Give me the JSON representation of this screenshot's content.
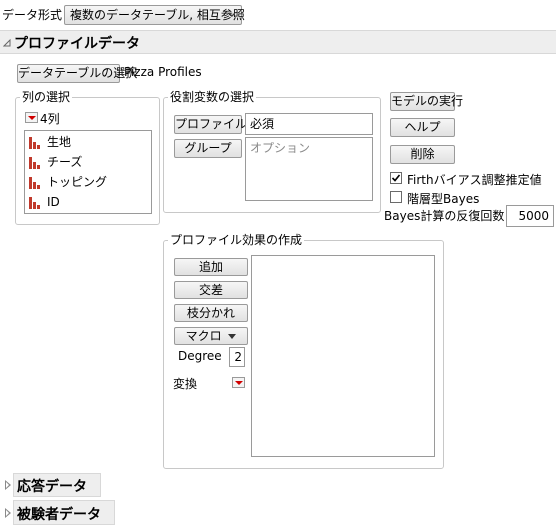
{
  "data_format": {
    "label": "データ形式",
    "value": "複数のデータテーブル, 相互参照"
  },
  "profile_section": {
    "title": "プロファイルデータ",
    "select_table_button": "データテーブルの選択",
    "table_name": "Pizza Profiles"
  },
  "column_select": {
    "title": "列の選択",
    "count_label": "4列",
    "columns": [
      "生地",
      "チーズ",
      "トッピング",
      "ID"
    ]
  },
  "role_select": {
    "title": "役割変数の選択",
    "profile_id_button": "プロファイルID",
    "profile_id_value": "必須",
    "group_button": "グループ",
    "group_placeholder": "オプション"
  },
  "actions": {
    "run_model": "モデルの実行",
    "help": "ヘルプ",
    "remove": "削除",
    "firth_label": "Firthバイアス調整推定値",
    "firth_checked": true,
    "bayes_label": "階層型Bayes",
    "bayes_checked": false,
    "bayes_iter_label": "Bayes計算の反復回数",
    "bayes_iter_value": "5000"
  },
  "effects": {
    "title": "プロファイル効果の作成",
    "add": "追加",
    "cross": "交差",
    "nest": "枝分かれ",
    "macro": "マクロ",
    "degree_label": "Degree",
    "degree_value": "2",
    "transform_label": "変換"
  },
  "collapsed_sections": {
    "response": "応答データ",
    "subject": "被験者データ"
  },
  "colors": {
    "accent_red": "#d00000",
    "icon_red": "#c0392b"
  }
}
